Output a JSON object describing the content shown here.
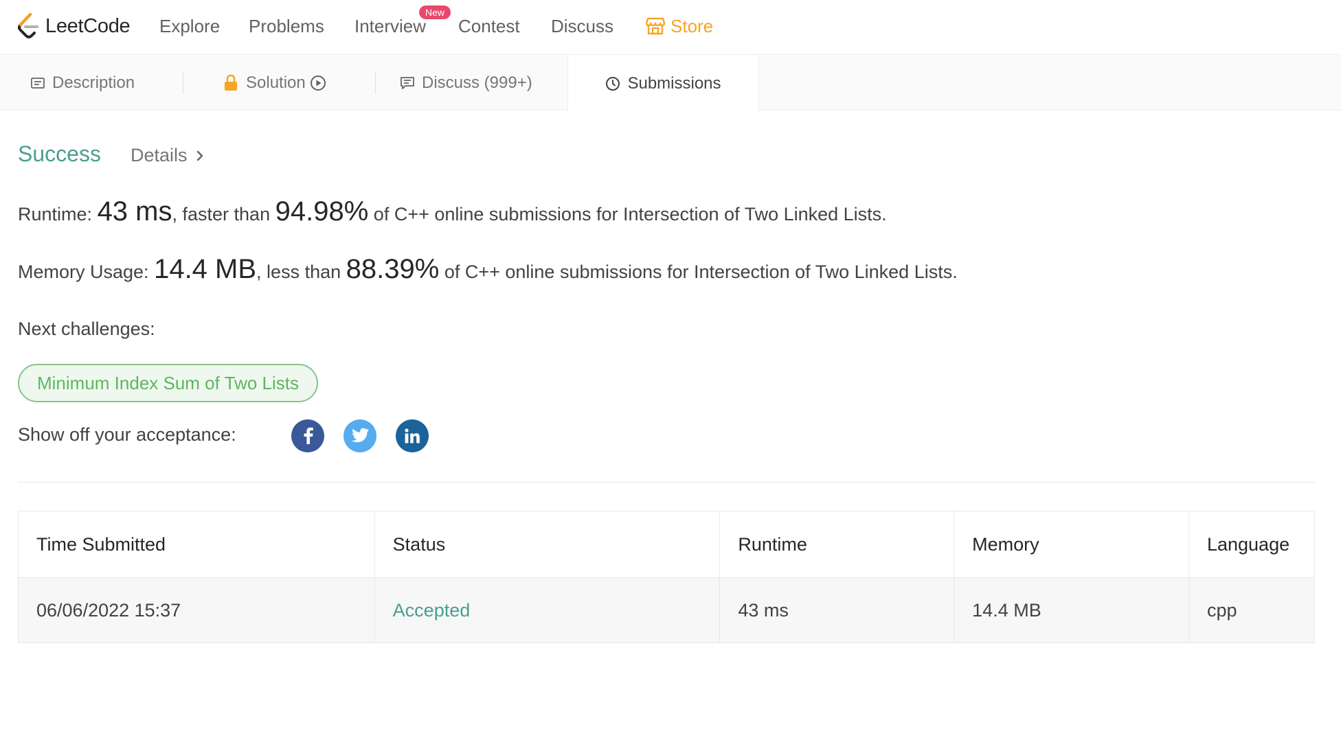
{
  "nav": {
    "logo_text": "LeetCode",
    "items": [
      "Explore",
      "Problems",
      "Interview",
      "Contest",
      "Discuss"
    ],
    "badge": "New",
    "store": "Store",
    "store_color": "#f5a623"
  },
  "tabs": {
    "description": "Description",
    "solution": "Solution",
    "discuss": "Discuss (999+)",
    "submissions": "Submissions"
  },
  "result": {
    "status": "Success",
    "details": "Details",
    "runtime_label": "Runtime:",
    "runtime_value": "43 ms",
    "runtime_mid": ", faster than",
    "runtime_pct": "94.98%",
    "runtime_tail": "of C++ online submissions for Intersection of Two Linked Lists.",
    "memory_label": "Memory Usage:",
    "memory_value": "14.4 MB",
    "memory_mid": ", less than",
    "memory_pct": "88.39%",
    "memory_tail": "of C++ online submissions for Intersection of Two Linked Lists.",
    "next_label": "Next challenges:",
    "next_challenge": "Minimum Index Sum of Two Lists",
    "share_label": "Show off your acceptance:"
  },
  "table": {
    "headers": [
      "Time Submitted",
      "Status",
      "Runtime",
      "Memory",
      "Language"
    ],
    "rows": [
      [
        "06/06/2022 15:37",
        "Accepted",
        "43 ms",
        "14.4 MB",
        "cpp"
      ]
    ]
  },
  "colors": {
    "success": "#4a9e8e",
    "pill_text": "#5fb560",
    "badge": "#e8486c"
  }
}
